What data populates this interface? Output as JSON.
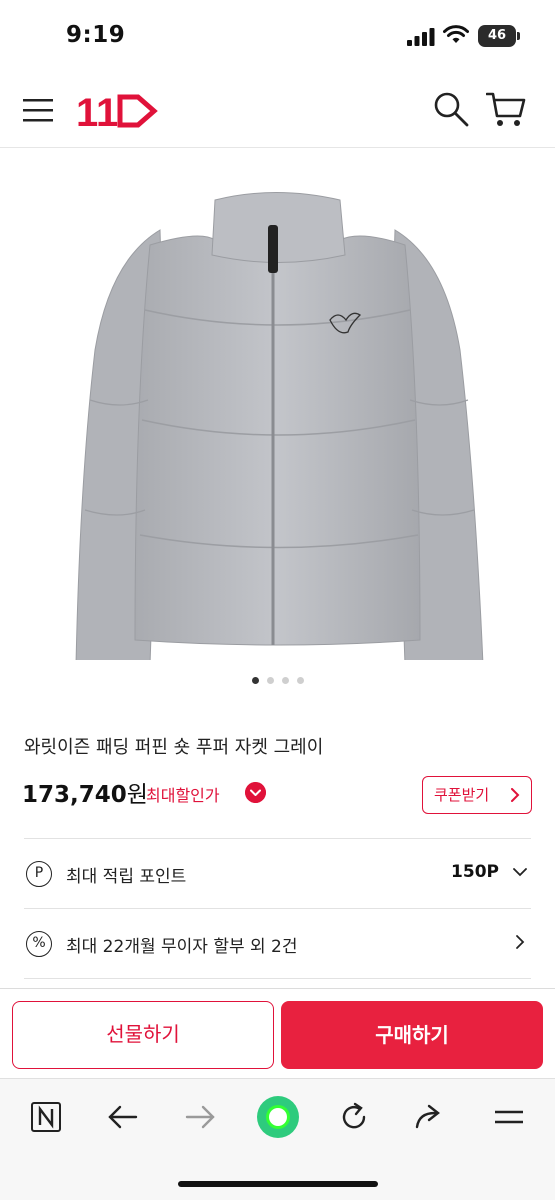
{
  "status_bar": {
    "time": "9:19",
    "battery": "46"
  },
  "header": {
    "logo_text": "11",
    "brand_color": "#e0123a"
  },
  "product": {
    "image_pages": 4,
    "active_page": 1,
    "title": "와릿이즌 패딩 퍼핀 숏 푸퍼 자켓 그레이",
    "price": "173,740",
    "price_unit": "원",
    "max_discount_label": "최대할인가",
    "coupon_button": "쿠폰받기"
  },
  "info_rows": [
    {
      "icon": "P",
      "label": "최대 적립 포인트",
      "value": "150P"
    },
    {
      "icon": "%",
      "label": "최대 22개월 무이자 할부 외 2건",
      "value": ""
    }
  ],
  "actions": {
    "gift": "선물하기",
    "buy": "구매하기"
  },
  "browser_toolbar": {
    "icons": [
      "naver-icon",
      "back-arrow-icon",
      "forward-arrow-icon",
      "green-dot-icon",
      "reload-icon",
      "share-icon",
      "menu-icon"
    ]
  }
}
